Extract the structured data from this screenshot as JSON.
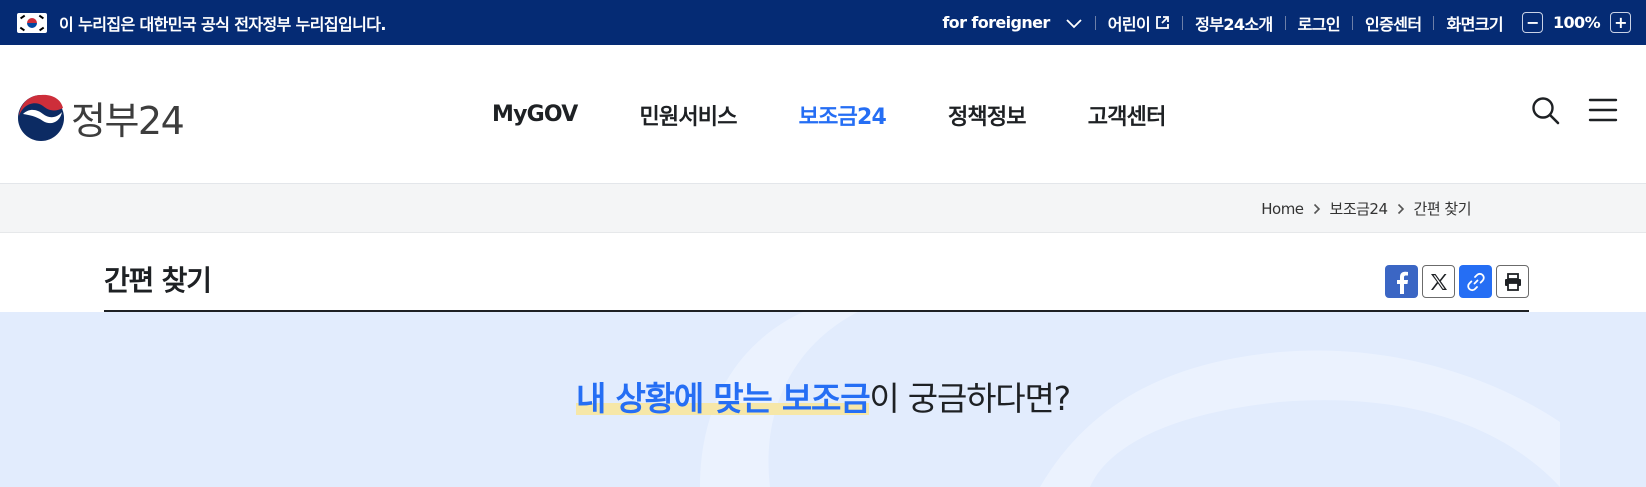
{
  "gov_bar": {
    "notice": "이 누리집은 대한민국 공식 전자정부 누리집입니다.",
    "utility": {
      "foreigner": "for foreigner",
      "kids": "어린이",
      "about": "정부24소개",
      "login": "로그인",
      "cert": "인증센터",
      "screen_size": "화면크기",
      "zoom_minus": "−",
      "zoom_value": "100%",
      "zoom_plus": "+"
    }
  },
  "header": {
    "logo_text": "정부24",
    "nav": [
      "MyGOV",
      "민원서비스",
      "보조금24",
      "정책정보",
      "고객센터"
    ],
    "active_nav": "보조금24"
  },
  "breadcrumb": [
    "Home",
    "보조금24",
    "간편 찾기"
  ],
  "page": {
    "title": "간편 찾기"
  },
  "hero": {
    "emphasis": "내 상황에 맞는 보조금",
    "rest": "이 궁금하다면?"
  },
  "colors": {
    "gov_bar": "#052b74",
    "accent": "#256ef4",
    "hero_bg": "#e2ecfd",
    "highlight": "#f6e7a8"
  }
}
